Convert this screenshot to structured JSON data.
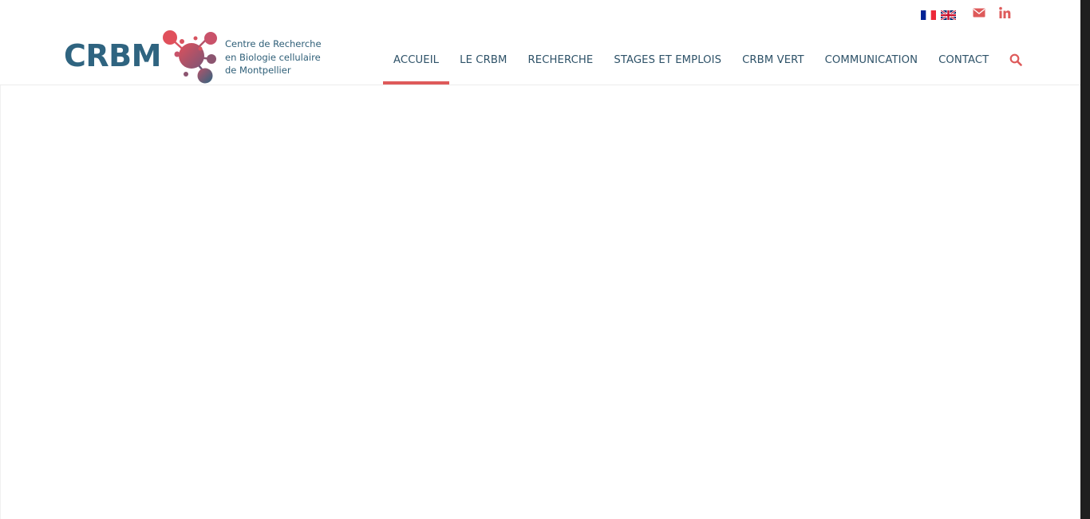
{
  "topbar": {
    "flags": [
      {
        "name": "fr-flag-icon",
        "colors": [
          "#002395",
          "#ffffff",
          "#ed2939"
        ]
      },
      {
        "name": "uk-flag-icon",
        "colors": [
          "#012169",
          "#ffffff",
          "#c8102e"
        ]
      }
    ],
    "social": [
      {
        "name": "mail-icon",
        "color": "#de5a5a"
      },
      {
        "name": "linkedin-icon",
        "color": "#de5a5a",
        "glyph": "in"
      }
    ]
  },
  "logo": {
    "wordmark": "CRBM",
    "subtitle_lines": [
      "Centre de Recherche",
      "en Biologie cellulaire",
      "de Montpellier"
    ],
    "colors": {
      "primary": "#2f6480",
      "accent": "#de5a5a"
    }
  },
  "nav": {
    "items": [
      {
        "label": "ACCUEIL",
        "active": true
      },
      {
        "label": "LE CRBM",
        "active": false
      },
      {
        "label": "RECHERCHE",
        "active": false
      },
      {
        "label": "STAGES ET EMPLOIS",
        "active": false
      },
      {
        "label": "CRBM VERT",
        "active": false
      },
      {
        "label": "COMMUNICATION",
        "active": false
      },
      {
        "label": "CONTACT",
        "active": false
      }
    ],
    "search_icon": "search-icon",
    "active_color": "#de5a5a",
    "text_color": "#2e5268"
  }
}
